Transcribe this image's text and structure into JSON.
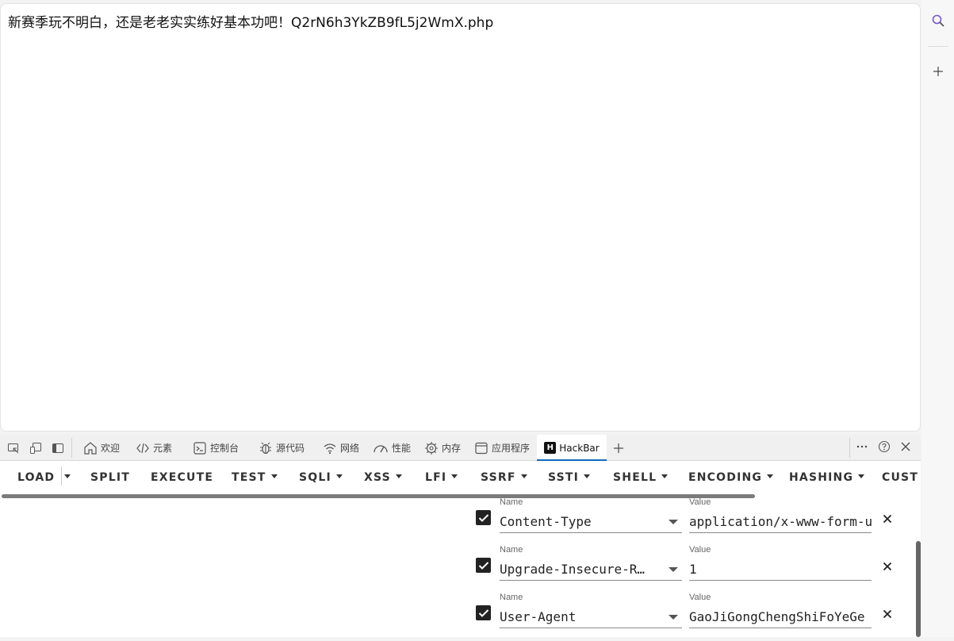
{
  "page": {
    "text": "新赛季玩不明白，还是老老实实练好基本功吧！Q2rN6h3YkZB9fL5j2WmX.php"
  },
  "sidebar": {
    "icons": [
      "search-icon",
      "add-icon"
    ]
  },
  "devtools": {
    "tabs": [
      {
        "label": "欢迎",
        "icon": "home-icon"
      },
      {
        "label": "元素",
        "icon": "code-icon"
      },
      {
        "label": "控制台",
        "icon": "console-icon"
      },
      {
        "label": "源代码",
        "icon": "bug-icon"
      },
      {
        "label": "网络",
        "icon": "wifi-icon"
      },
      {
        "label": "性能",
        "icon": "gauge-icon"
      },
      {
        "label": "内存",
        "icon": "memory-icon"
      },
      {
        "label": "应用程序",
        "icon": "app-icon"
      },
      {
        "label": "HackBar",
        "icon": "hackbar-logo-icon",
        "active": true
      }
    ],
    "hackbar_logo_letter": "H"
  },
  "hackbar": {
    "menu": [
      {
        "label": "LOAD",
        "caret": false
      },
      {
        "label": "SPLIT",
        "caret": false
      },
      {
        "label": "EXECUTE",
        "caret": false
      },
      {
        "label": "TEST",
        "caret": true
      },
      {
        "label": "SQLI",
        "caret": true
      },
      {
        "label": "XSS",
        "caret": true
      },
      {
        "label": "LFI",
        "caret": true
      },
      {
        "label": "SSRF",
        "caret": true
      },
      {
        "label": "SSTI",
        "caret": true
      },
      {
        "label": "SHELL",
        "caret": true
      },
      {
        "label": "ENCODING",
        "caret": true
      },
      {
        "label": "HASHING",
        "caret": true
      },
      {
        "label": "CUSTO",
        "caret": false
      }
    ],
    "name_label": "Name",
    "value_label": "Value",
    "headers": [
      {
        "enabled": true,
        "name": "Content-Type",
        "value": "application/x-www-form-u"
      },
      {
        "enabled": true,
        "name": "Upgrade-Insecure-R…",
        "value": "1"
      },
      {
        "enabled": true,
        "name": "User-Agent",
        "value": "GaoJiGongChengShiFoYeGe"
      }
    ]
  }
}
